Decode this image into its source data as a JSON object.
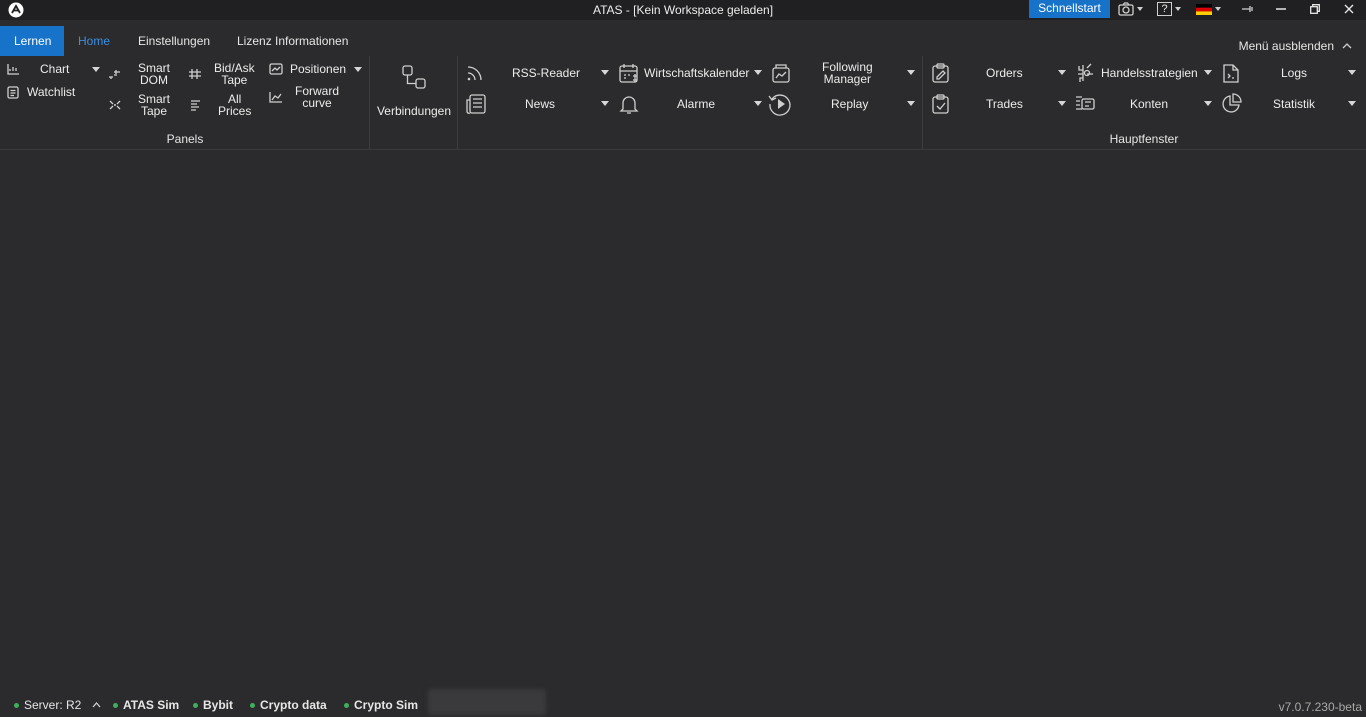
{
  "window": {
    "title": "ATAS - [Kein Workspace geladen]",
    "quickstart": "Schnellstart",
    "help_label": "?",
    "icons": [
      "atas-logo-icon",
      "camera-icon",
      "help-icon",
      "german-flag-icon",
      "pin-icon",
      "minimize-icon",
      "restore-icon",
      "close-icon"
    ]
  },
  "tabs": [
    {
      "label": "Lernen"
    },
    {
      "label": "Home"
    },
    {
      "label": "Einstellungen"
    },
    {
      "label": "Lizenz Informationen"
    }
  ],
  "hide_menu": "Menü ausblenden",
  "ribbon": {
    "panels": {
      "chart": "Chart",
      "watchlist": "Watchlist",
      "smart_dom": [
        "Smart",
        "DOM"
      ],
      "smart_tape": [
        "Smart",
        "Tape"
      ],
      "bidask_tape": [
        "Bid/Ask",
        "Tape"
      ],
      "all_prices": [
        "All",
        "Prices"
      ],
      "positionen": "Positionen",
      "forward_curve": [
        "Forward",
        "curve"
      ],
      "group": "Panels"
    },
    "verbindungen": "Verbindungen",
    "middle": {
      "rss": "RSS-Reader",
      "news": "News",
      "calendar": "Wirtschaftskalender",
      "alarms": "Alarme",
      "following_manager": [
        "Following",
        "Manager"
      ],
      "replay": "Replay"
    },
    "hauptfenster": {
      "orders": "Orders",
      "trades": "Trades",
      "strategies": "Handelsstrategien",
      "accounts": "Konten",
      "logs": "Logs",
      "statistics": "Statistik",
      "group": "Hauptfenster"
    }
  },
  "status": {
    "server": "Server: R2",
    "connections": [
      "ATAS Sim",
      "Bybit",
      "Crypto data",
      "Crypto Sim"
    ],
    "version": "v7.0.7.230-beta",
    "status_color": "#3fae5b"
  },
  "colors": {
    "accent": "#1673c9",
    "background": "#2b2b2d",
    "titlebar": "#202022"
  }
}
